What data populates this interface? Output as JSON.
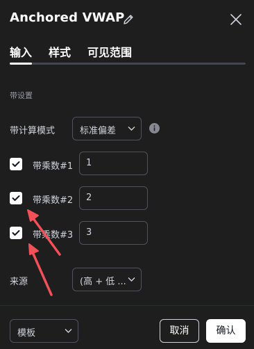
{
  "header": {
    "title": "Anchored VWAP",
    "edit_icon": "pencil-icon",
    "close_icon": "close-icon"
  },
  "tabs": [
    {
      "label": "输入",
      "active": true
    },
    {
      "label": "样式",
      "active": false
    },
    {
      "label": "可见范围",
      "active": false
    }
  ],
  "section": {
    "title": "带设置"
  },
  "calc_mode": {
    "label": "带计算模式",
    "value": "标准偏差",
    "info_icon": "info-icon"
  },
  "bands": [
    {
      "label": "带乘数#1",
      "checked": true,
      "value": "1"
    },
    {
      "label": "带乘数#2",
      "checked": true,
      "value": "2"
    },
    {
      "label": "带乘数#3",
      "checked": true,
      "value": "3"
    }
  ],
  "source": {
    "label": "来源",
    "value": "(高 + 低 ..."
  },
  "footer": {
    "template_label": "模板",
    "cancel_label": "取消",
    "ok_label": "确认"
  },
  "colors": {
    "background": "#1e1e1e",
    "annotation_arrow": "#f25257",
    "accent": "#ffffff"
  }
}
